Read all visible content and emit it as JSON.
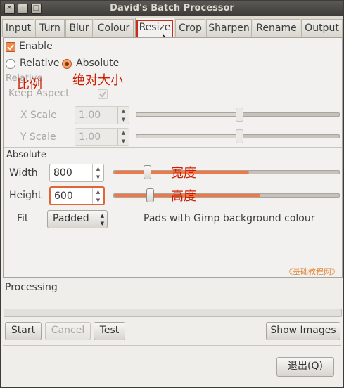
{
  "window": {
    "title": "David's Batch Processor"
  },
  "tabs": [
    {
      "label": "Input"
    },
    {
      "label": "Turn"
    },
    {
      "label": "Blur"
    },
    {
      "label": "Colour"
    },
    {
      "label": "Resize"
    },
    {
      "label": "Crop"
    },
    {
      "label": "Sharpen"
    },
    {
      "label": "Rename"
    },
    {
      "label": "Output"
    }
  ],
  "resize": {
    "enable_label": "Enable",
    "enable_checked": true,
    "relative_label": "Relative",
    "absolute_label": "Absolute",
    "mode": "Absolute",
    "relative_section_label": "Relative",
    "keep_aspect_label": "Keep Aspect",
    "x_scale_label": "X Scale",
    "x_scale_value": "1.00",
    "y_scale_label": "Y Scale",
    "y_scale_value": "1.00",
    "absolute_section_label": "Absolute",
    "width_label": "Width",
    "width_value": "800",
    "height_label": "Height",
    "height_value": "600",
    "fit_label": "Fit",
    "fit_value": "Padded",
    "fit_description": "Pads with Gimp background colour",
    "x_scale_level": 0.51,
    "y_scale_level": 0.51,
    "width_level": 0.6,
    "height_level": 0.65
  },
  "annotations": {
    "relative_cn": "比例",
    "absolute_cn": "绝对大小",
    "width_cn": "宽度",
    "height_cn": "高度",
    "watermark": "《基础教程网》"
  },
  "processing": {
    "label": "Processing"
  },
  "buttons": {
    "start": "Start",
    "cancel": "Cancel",
    "test": "Test",
    "show_images": "Show Images",
    "quit": "退出(Q)"
  },
  "colors": {
    "accent": "#f07746",
    "annotation_red": "#cc1e00",
    "titlebar": "#3c3b37"
  }
}
